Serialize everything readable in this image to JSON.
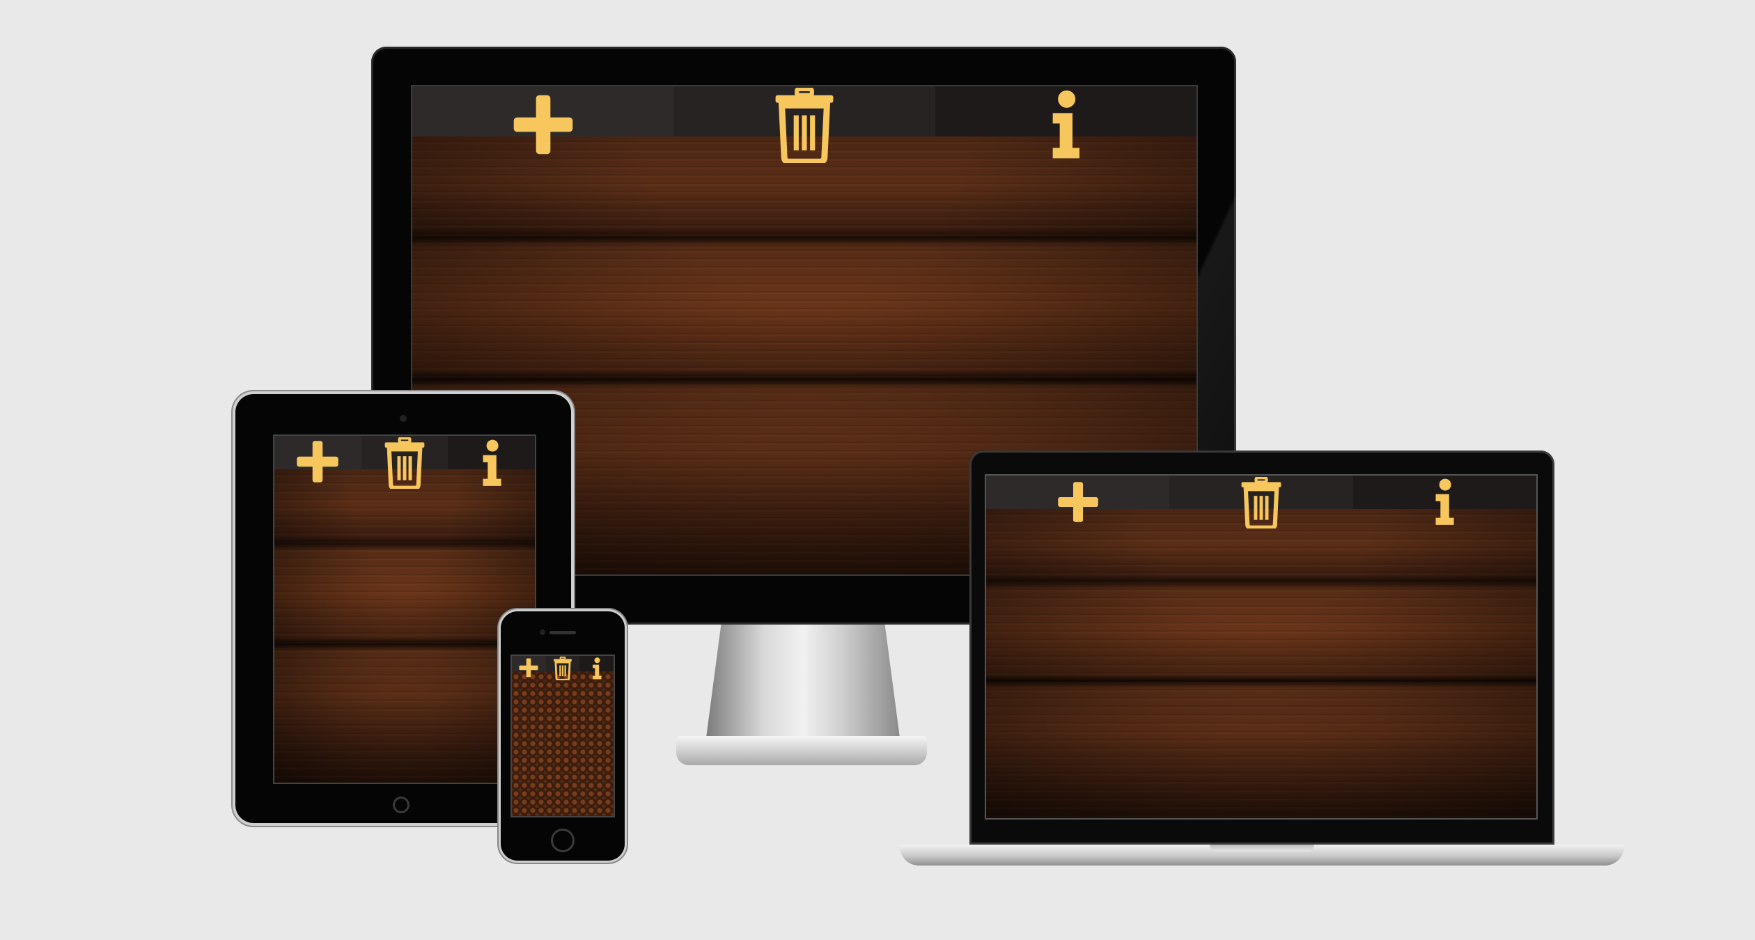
{
  "app": {
    "accent_color": "#f7c65c",
    "background_color": "#e9e9e9",
    "nav_colors": [
      "#2e2a2a",
      "#272323",
      "#1f1a1a"
    ]
  },
  "navbar": {
    "items": [
      {
        "icon": "plus-icon",
        "action": "add"
      },
      {
        "icon": "trash-icon",
        "action": "delete"
      },
      {
        "icon": "info-icon",
        "action": "info"
      }
    ]
  },
  "devices": [
    "desktop-monitor",
    "laptop",
    "tablet",
    "phone"
  ]
}
